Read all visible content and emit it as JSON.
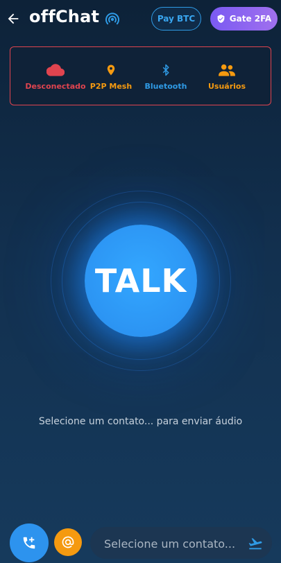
{
  "header": {
    "title": "offChat",
    "pay_btc_label": "Pay BTC",
    "gate_2fa_label": "Gate 2FA"
  },
  "status_bar": {
    "items": [
      {
        "label": "Desconectado",
        "icon": "cloud-icon",
        "color": "#e0444f"
      },
      {
        "label": "P2P Mesh",
        "icon": "location-pin-icon",
        "color": "#f59a10"
      },
      {
        "label": "Bluetooth",
        "icon": "bluetooth-icon",
        "color": "#2f9be6"
      },
      {
        "label": "Usuários",
        "icon": "users-icon",
        "color": "#f59a10"
      }
    ]
  },
  "talk_button": {
    "label": "TALK"
  },
  "hint": "Selecione um contato... para enviar áudio",
  "composer": {
    "placeholder": "Selecione um contato..."
  },
  "colors": {
    "accent": "#2d93ee",
    "warning": "#f59a10",
    "error": "#e0444f",
    "purple": "#8a63f0"
  }
}
